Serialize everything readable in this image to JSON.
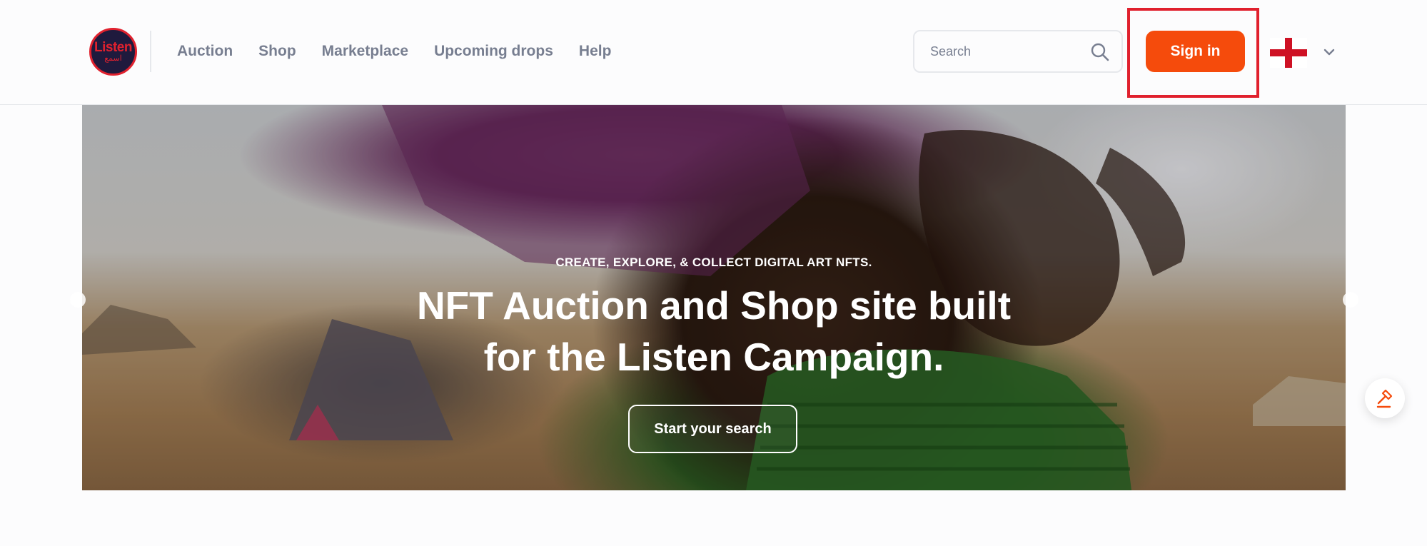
{
  "header": {
    "logo": {
      "line1": "Listen",
      "line2": "اسمع"
    },
    "nav": [
      {
        "label": "Auction"
      },
      {
        "label": "Shop"
      },
      {
        "label": "Marketplace"
      },
      {
        "label": "Upcoming drops"
      },
      {
        "label": "Help"
      }
    ],
    "search": {
      "placeholder": "Search",
      "value": ""
    },
    "signin_label": "Sign in",
    "language": {
      "icon": "england-flag-icon"
    },
    "colors": {
      "accent": "#f54b0c",
      "highlight_box": "#e0202d",
      "nav_text": "#777e90"
    }
  },
  "hero": {
    "eyebrow": "CREATE, EXPLORE, & COLLECT DIGITAL ART NFTS.",
    "title_line1": "NFT Auction and Shop site built",
    "title_line2": "for the Listen Campaign.",
    "cta_label": "Start your search"
  },
  "floating_button": {
    "icon": "auction-gavel-icon"
  }
}
